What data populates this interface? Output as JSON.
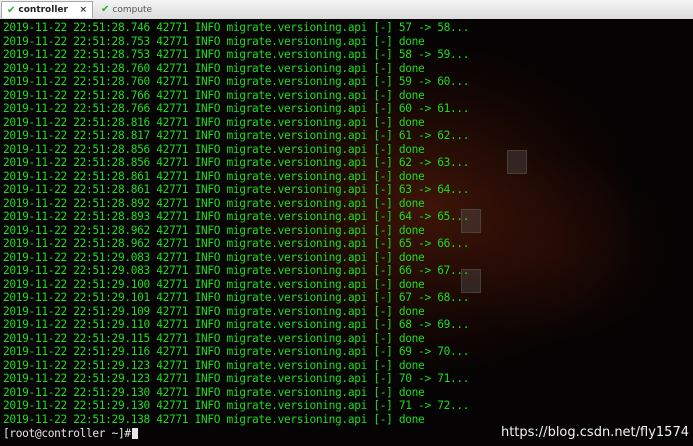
{
  "tabs": [
    {
      "label": "controller",
      "close": "×",
      "active": true
    },
    {
      "label": "compute",
      "active": false
    }
  ],
  "log_lines": [
    "2019-11-22 22:51:28.746 42771 INFO migrate.versioning.api [-] 57 -> 58...",
    "2019-11-22 22:51:28.753 42771 INFO migrate.versioning.api [-] done",
    "2019-11-22 22:51:28.753 42771 INFO migrate.versioning.api [-] 58 -> 59...",
    "2019-11-22 22:51:28.760 42771 INFO migrate.versioning.api [-] done",
    "2019-11-22 22:51:28.760 42771 INFO migrate.versioning.api [-] 59 -> 60...",
    "2019-11-22 22:51:28.766 42771 INFO migrate.versioning.api [-] done",
    "2019-11-22 22:51:28.766 42771 INFO migrate.versioning.api [-] 60 -> 61...",
    "2019-11-22 22:51:28.816 42771 INFO migrate.versioning.api [-] done",
    "2019-11-22 22:51:28.817 42771 INFO migrate.versioning.api [-] 61 -> 62...",
    "2019-11-22 22:51:28.856 42771 INFO migrate.versioning.api [-] done",
    "2019-11-22 22:51:28.856 42771 INFO migrate.versioning.api [-] 62 -> 63...",
    "2019-11-22 22:51:28.861 42771 INFO migrate.versioning.api [-] done",
    "2019-11-22 22:51:28.861 42771 INFO migrate.versioning.api [-] 63 -> 64...",
    "2019-11-22 22:51:28.892 42771 INFO migrate.versioning.api [-] done",
    "2019-11-22 22:51:28.893 42771 INFO migrate.versioning.api [-] 64 -> 65...",
    "2019-11-22 22:51:28.962 42771 INFO migrate.versioning.api [-] done",
    "2019-11-22 22:51:28.962 42771 INFO migrate.versioning.api [-] 65 -> 66...",
    "2019-11-22 22:51:29.083 42771 INFO migrate.versioning.api [-] done",
    "2019-11-22 22:51:29.083 42771 INFO migrate.versioning.api [-] 66 -> 67...",
    "2019-11-22 22:51:29.100 42771 INFO migrate.versioning.api [-] done",
    "2019-11-22 22:51:29.101 42771 INFO migrate.versioning.api [-] 67 -> 68...",
    "2019-11-22 22:51:29.109 42771 INFO migrate.versioning.api [-] done",
    "2019-11-22 22:51:29.110 42771 INFO migrate.versioning.api [-] 68 -> 69...",
    "2019-11-22 22:51:29.115 42771 INFO migrate.versioning.api [-] done",
    "2019-11-22 22:51:29.116 42771 INFO migrate.versioning.api [-] 69 -> 70...",
    "2019-11-22 22:51:29.123 42771 INFO migrate.versioning.api [-] done",
    "2019-11-22 22:51:29.123 42771 INFO migrate.versioning.api [-] 70 -> 71...",
    "2019-11-22 22:51:29.130 42771 INFO migrate.versioning.api [-] done",
    "2019-11-22 22:51:29.130 42771 INFO migrate.versioning.api [-] 71 -> 72...",
    "2019-11-22 22:51:29.138 42771 INFO migrate.versioning.api [-] done"
  ],
  "prompt": "[root@controller ~]#",
  "watermark": "https://blog.csdn.net/fly1574",
  "colors": {
    "log_text": "#1edc1e",
    "prompt_text": "#e6e6e6",
    "tab_check": "#2eaa2e"
  }
}
